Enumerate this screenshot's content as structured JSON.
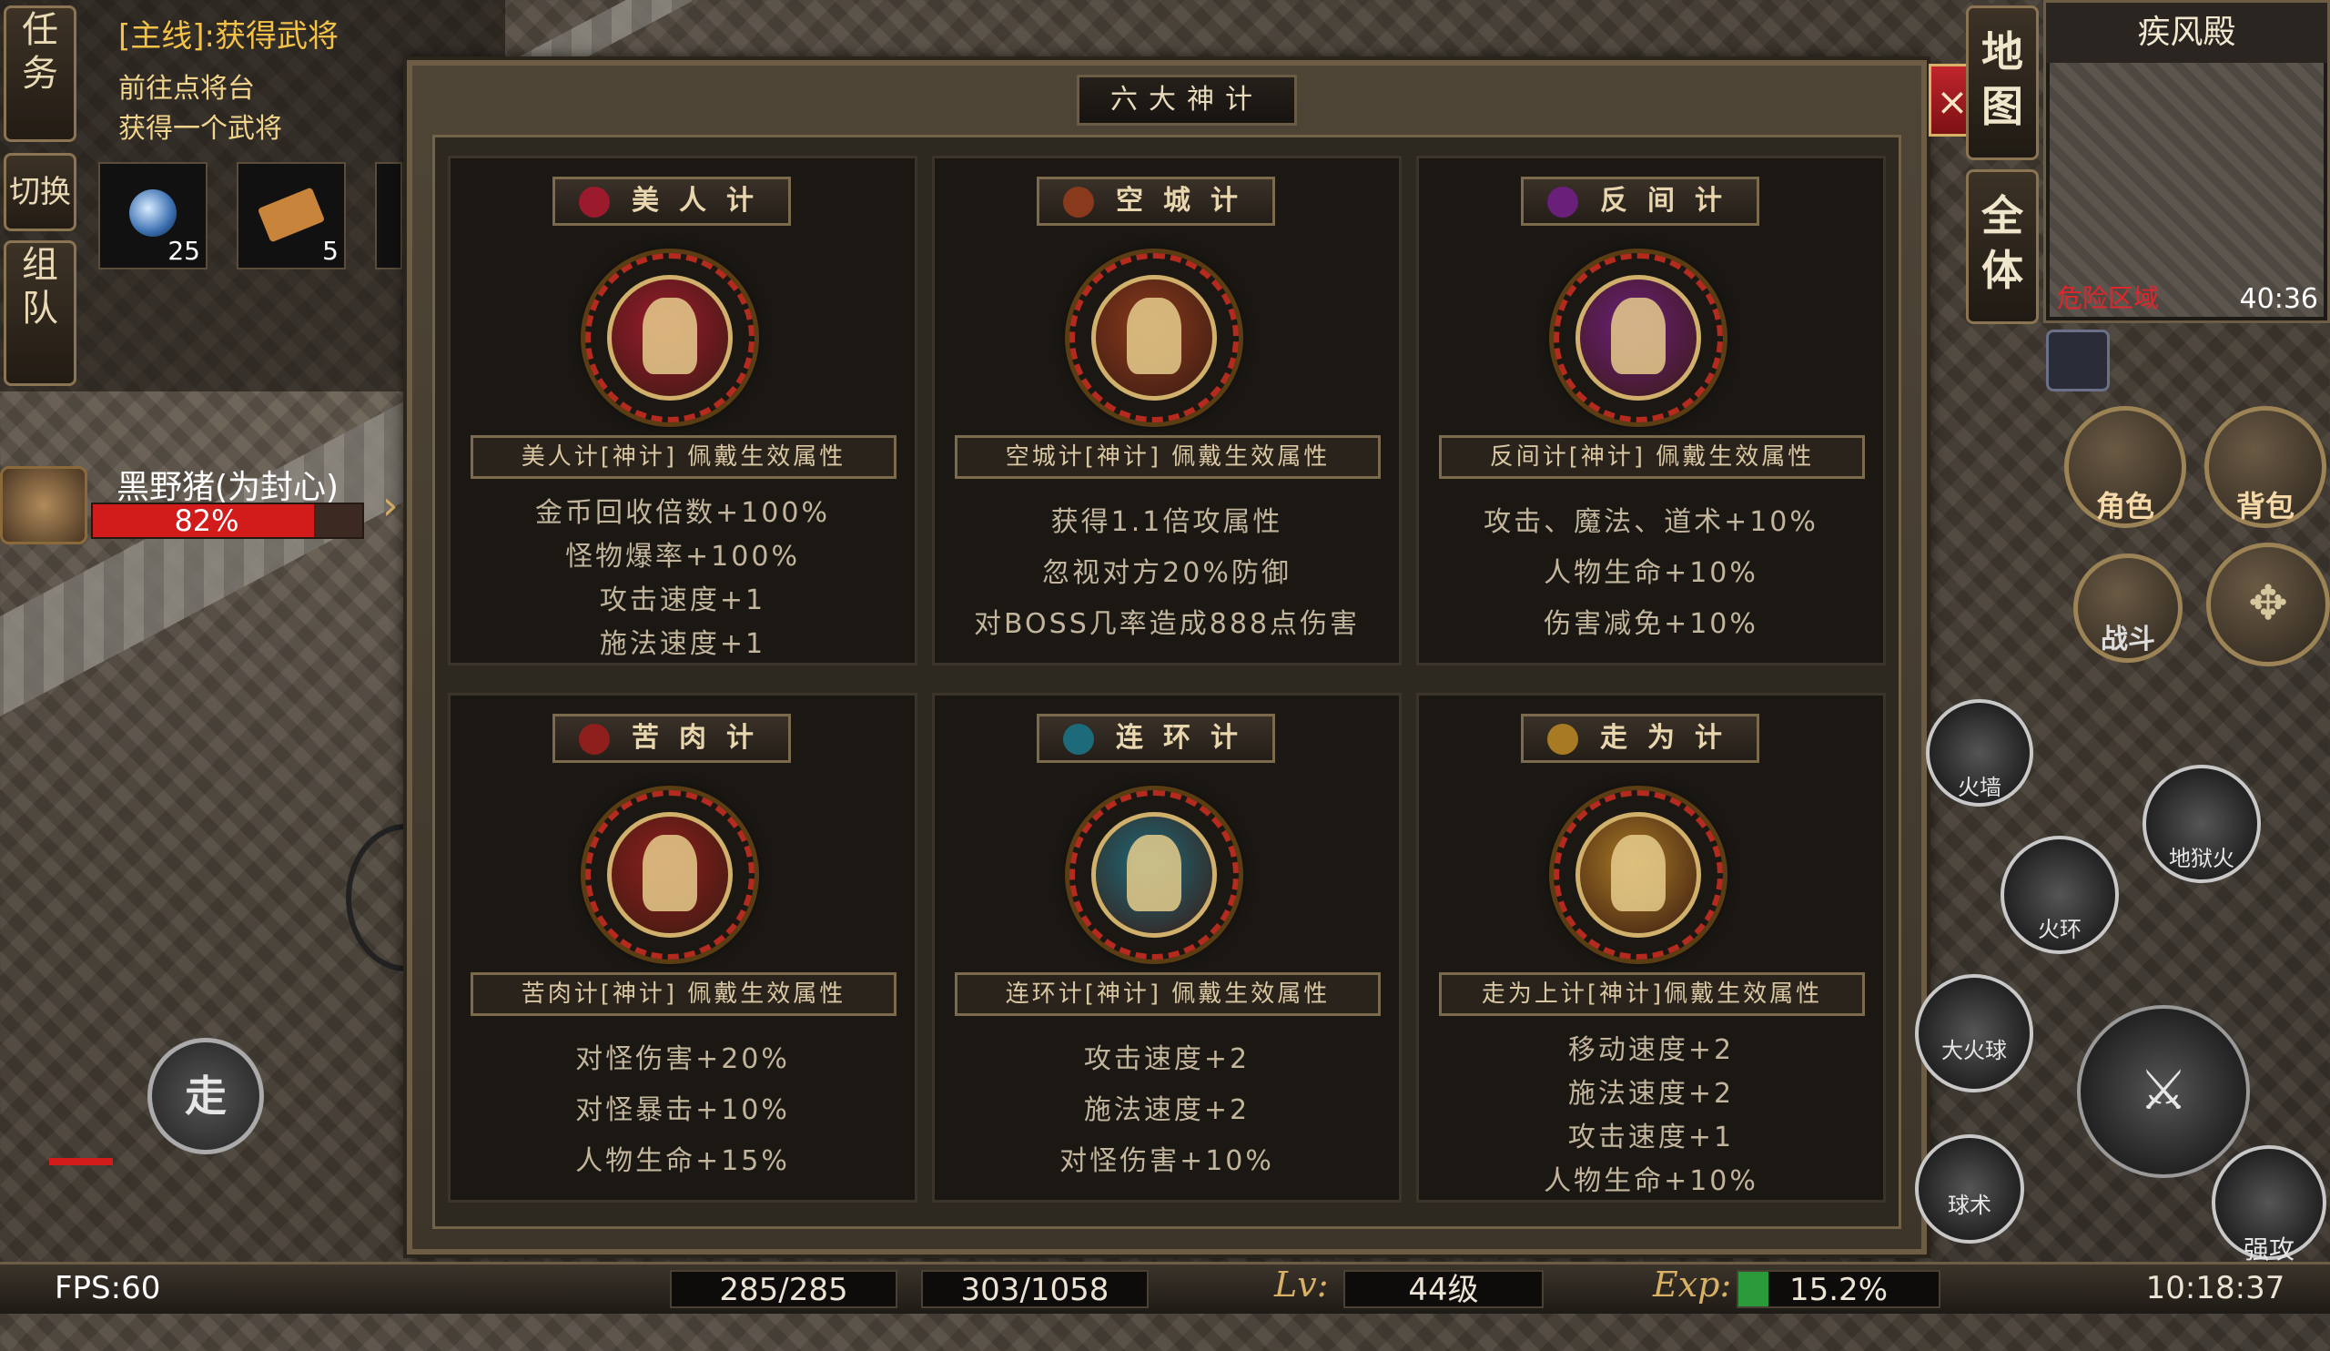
{
  "quest": {
    "tab_task": "任务",
    "tab_switch": "切换",
    "tab_team": "组队",
    "title": "[主线]:获得武将",
    "line1": "前往点将台",
    "line2": "获得一个武将",
    "items": [
      {
        "count": "25"
      },
      {
        "count": "5"
      }
    ]
  },
  "target": {
    "name": "黑野猪(为封心)",
    "hp_text": "82%",
    "hp_fraction": 0.82
  },
  "dialog": {
    "title": "六大神计",
    "close_label": "×",
    "cards": [
      {
        "name": "美人计",
        "attr": "美人计[神计]  佩戴生效属性",
        "lines": [
          "金币回收倍数+100%",
          "怪物爆率+100%",
          "攻击速度+1",
          "施法速度+1"
        ],
        "color": "#9b1b2c"
      },
      {
        "name": "空城计",
        "attr": "空城计[神计]  佩戴生效属性",
        "lines": [
          "获得1.1倍攻属性",
          "忽视对方20%防御",
          "对BOSS几率造成888点伤害"
        ],
        "color": "#8a3a1c"
      },
      {
        "name": "反间计",
        "attr": "反间计[神计]  佩戴生效属性",
        "lines": [
          "攻击、魔法、道术+10%",
          "人物生命+10%",
          "伤害减免+10%"
        ],
        "color": "#6a1f7a"
      },
      {
        "name": "苦肉计",
        "attr": "苦肉计[神计]  佩戴生效属性",
        "lines": [
          "对怪伤害+20%",
          "对怪暴击+10%",
          "人物生命+15%"
        ],
        "color": "#8e1f1c"
      },
      {
        "name": "连环计",
        "attr": "连环计[神计]  佩戴生效属性",
        "lines": [
          "攻击速度+2",
          "施法速度+2",
          "对怪伤害+10%"
        ],
        "color": "#1c6a7a"
      },
      {
        "name": "走为计",
        "attr": "走为上计[神计]佩戴生效属性",
        "lines": [
          "移动速度+2",
          "施法速度+2",
          "攻击速度+1",
          "人物生命+10%"
        ],
        "color": "#a87a24"
      }
    ]
  },
  "map": {
    "tab_map": "地图",
    "tab_all": "全体",
    "location": "疾风殿",
    "zone": "危险区域",
    "coords": "40:36"
  },
  "actions": {
    "character": "角色",
    "bag": "背包",
    "battle": "战斗",
    "walk": "走",
    "skills": [
      "火墙",
      "地狱火",
      "火环",
      "大火球",
      "球术",
      "强攻"
    ]
  },
  "status": {
    "fps": "FPS:60",
    "hp": "285/285",
    "mp": "303/1058",
    "lv_label": "Lv:",
    "level": "44级",
    "exp_label": "Exp:",
    "exp": "15.2%",
    "exp_fraction": 0.152,
    "time": "10:18:37"
  }
}
